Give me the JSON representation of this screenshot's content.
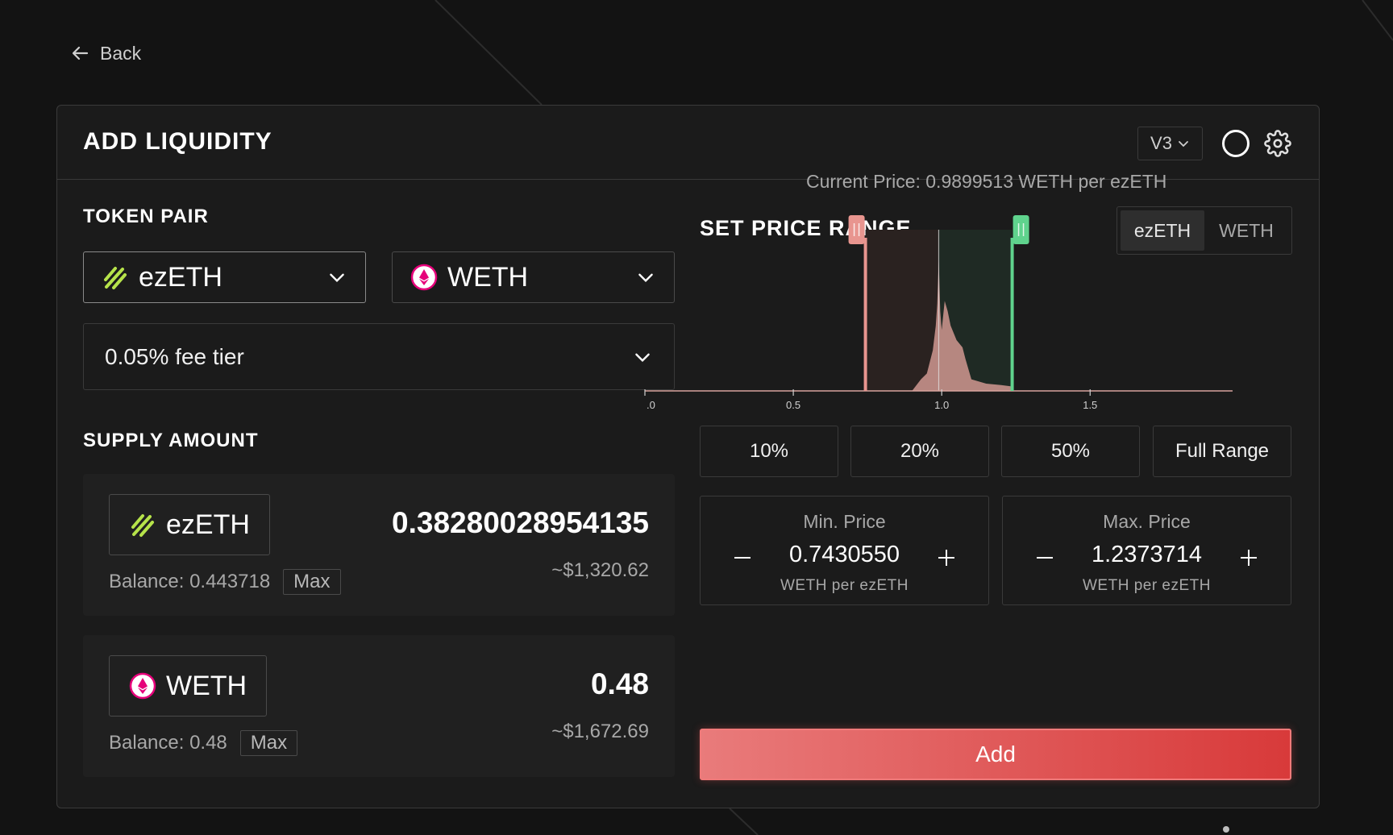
{
  "nav": {
    "back_label": "Back"
  },
  "panel": {
    "title": "ADD LIQUIDITY",
    "version_label": "V3"
  },
  "token_pair": {
    "title": "TOKEN PAIR",
    "token_a": "ezETH",
    "token_b": "WETH",
    "fee_tier": "0.05% fee tier"
  },
  "supply": {
    "title": "SUPPLY AMOUNT",
    "token_a": {
      "symbol": "ezETH",
      "amount": "0.38280028954135",
      "usd": "~$1,320.62",
      "balance": "Balance: 0.443718",
      "max_label": "Max"
    },
    "token_b": {
      "symbol": "WETH",
      "amount": "0.48",
      "usd": "~$1,672.69",
      "balance": "Balance: 0.48",
      "max_label": "Max"
    }
  },
  "price_range": {
    "title": "SET PRICE RANGE",
    "toggle": [
      "ezETH",
      "WETH"
    ],
    "toggle_active": "ezETH",
    "current_price": "Current Price: 0.9899513 WETH per ezETH",
    "presets": [
      "10%",
      "20%",
      "50%",
      "Full Range"
    ],
    "min": {
      "label": "Min. Price",
      "value": "0.7430550",
      "unit": "WETH per ezETH"
    },
    "max": {
      "label": "Max. Price",
      "value": "1.2373714",
      "unit": "WETH per ezETH"
    },
    "add_label": "Add"
  },
  "colors": {
    "min_handle": "#e8958f",
    "max_handle": "#5fd38d",
    "add_button": "#e05a5a",
    "histogram": "#c7918b"
  },
  "chart_data": {
    "type": "area",
    "x_tick_labels": [
      ".0",
      "0.5",
      "1.0",
      "1.5"
    ],
    "x_ticks": [
      0,
      0.5,
      1.0,
      1.5
    ],
    "xlim": [
      0,
      1.98
    ],
    "current_price": 0.9899513,
    "range_min": 0.743055,
    "range_max": 1.2373714,
    "liquidity": {
      "x": [
        0.74,
        0.9,
        0.93,
        0.95,
        0.96,
        0.97,
        0.98,
        0.985,
        0.99,
        0.995,
        1.0,
        1.005,
        1.01,
        1.02,
        1.03,
        1.04,
        1.05,
        1.07,
        1.08,
        1.1,
        1.15,
        1.2,
        1.24
      ],
      "y": [
        0,
        0,
        0.08,
        0.12,
        0.2,
        0.28,
        0.45,
        0.6,
        0.9,
        0.55,
        0.42,
        0.52,
        0.62,
        0.55,
        0.45,
        0.4,
        0.35,
        0.3,
        0.22,
        0.08,
        0.05,
        0.04,
        0.03
      ]
    }
  }
}
